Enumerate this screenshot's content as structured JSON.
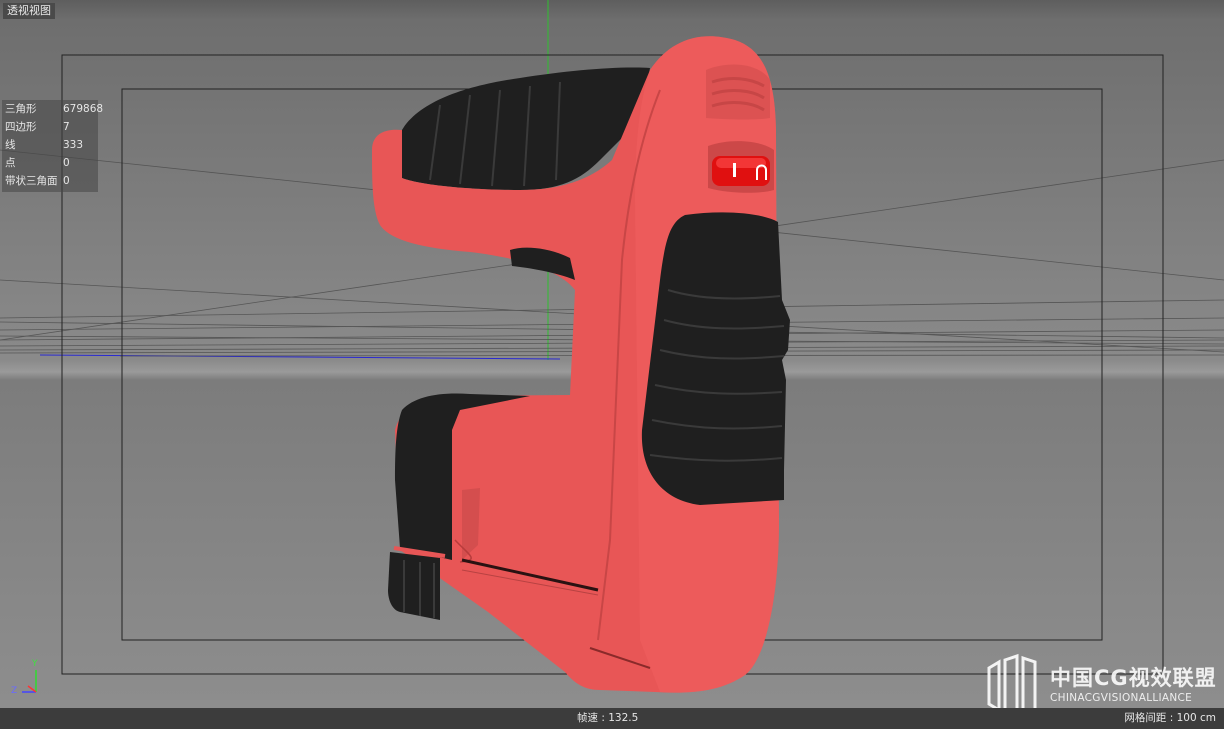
{
  "viewport": {
    "title": "透视视图"
  },
  "stats": [
    {
      "label": "三角形",
      "value": "679868"
    },
    {
      "label": "四边形",
      "value": "7"
    },
    {
      "label": "线",
      "value": "333"
    },
    {
      "label": "点",
      "value": "0"
    },
    {
      "label": "带状三角面",
      "value": "0"
    }
  ],
  "status": {
    "fps": "帧速 : 132.5",
    "grid_spacing": "网格间距 : 100 cm"
  },
  "watermark": {
    "title": "中国CG视效联盟",
    "subtitle": "CHINACGVISIONALLIANCE"
  },
  "axis": {
    "y": "Y",
    "z": "Z"
  },
  "colors": {
    "body": "#e85656",
    "grip": "#1e1e1e",
    "button": "#e01010"
  },
  "icons": [
    "axis-gizmo-icon",
    "watermark-logo-icon",
    "trigger-switch-icon"
  ]
}
